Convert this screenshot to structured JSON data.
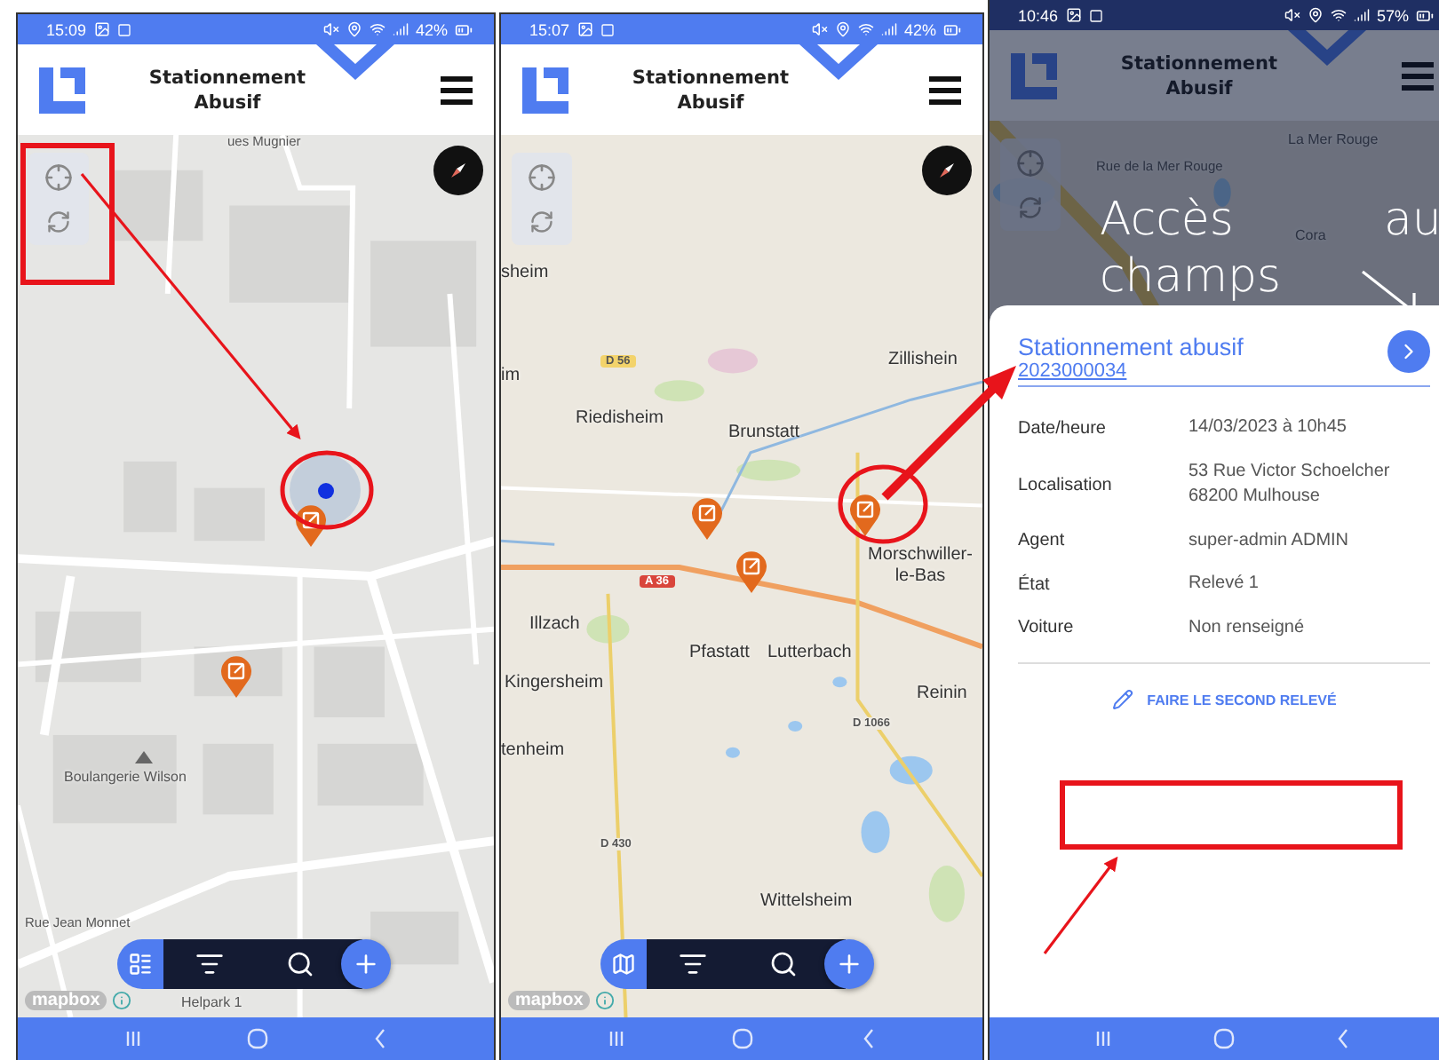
{
  "screens": [
    {
      "status_bar": {
        "time": "15:09",
        "battery": "42%"
      },
      "header": {
        "title": "Stationnement Abusif"
      },
      "dimmed": false,
      "map": {
        "kind": "street",
        "attribution": "mapbox",
        "labels": [
          {
            "text": "ues Mugnier",
            "kind": "street"
          },
          {
            "text": "Boulangerie Wilson",
            "kind": "poi"
          },
          {
            "text": "Rue Jean Monnet",
            "kind": "street"
          },
          {
            "text": "Helpark 1",
            "kind": "poi"
          }
        ]
      },
      "toolbar": {
        "kind": "list"
      }
    },
    {
      "status_bar": {
        "time": "15:07",
        "battery": "42%"
      },
      "header": {
        "title": "Stationnement Abusif"
      },
      "dimmed": false,
      "map": {
        "kind": "region",
        "attribution": "mapbox",
        "labels": [
          {
            "text": "sheim",
            "kind": "place"
          },
          {
            "text": "im",
            "kind": "place"
          },
          {
            "text": "D 56",
            "kind": "departmental_shield"
          },
          {
            "text": "Zillishein",
            "kind": "place"
          },
          {
            "text": "Riedisheim",
            "kind": "place"
          },
          {
            "text": "Brunstatt",
            "kind": "place"
          },
          {
            "text": "A 36",
            "kind": "highway_shield"
          },
          {
            "text": "Morschwiller-le-Bas",
            "kind": "place"
          },
          {
            "text": "Illzach",
            "kind": "place"
          },
          {
            "text": "Pfastatt",
            "kind": "place"
          },
          {
            "text": "Lutterbach",
            "kind": "place"
          },
          {
            "text": "Kingersheim",
            "kind": "place"
          },
          {
            "text": "Reinin",
            "kind": "place"
          },
          {
            "text": "D 1066",
            "kind": "road_number"
          },
          {
            "text": "tenheim",
            "kind": "place"
          },
          {
            "text": "D 430",
            "kind": "road_number"
          },
          {
            "text": "Wittelsheim",
            "kind": "place"
          }
        ]
      },
      "toolbar": {
        "kind": "map"
      }
    },
    {
      "status_bar": {
        "time": "10:46",
        "battery": "57%"
      },
      "header": {
        "title": "Stationnement Abusif"
      },
      "dimmed": true,
      "map": {
        "kind": "city",
        "labels": [
          {
            "text": "La Mer Rouge",
            "kind": "poi"
          },
          {
            "text": "Rue de la Mer Rouge",
            "kind": "street"
          },
          {
            "text": "Cora",
            "kind": "poi"
          }
        ]
      },
      "overlay_text": [
        "Accès",
        "au",
        "champs"
      ],
      "card": {
        "title": "Stationnement abusif",
        "number": "2023000034",
        "fields": [
          {
            "label": "Date/heure",
            "value": "14/03/2023 à 10h45"
          },
          {
            "label": "Localisation",
            "value": "53 Rue Victor Schoelcher 68200 Mulhouse"
          },
          {
            "label": "Agent",
            "value": "super-admin ADMIN"
          },
          {
            "label": "État",
            "value": "Relevé 1"
          },
          {
            "label": "Voiture",
            "value": "Non renseigné"
          }
        ],
        "action": "FAIRE LE SECOND RELEVÉ"
      }
    }
  ]
}
